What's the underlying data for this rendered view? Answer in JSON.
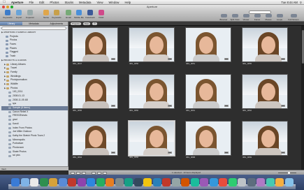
{
  "menubar": {
    "items": [
      "Aperture",
      "File",
      "Edit",
      "Photos",
      "Stacks",
      "Metadata",
      "View",
      "Window",
      "Help"
    ],
    "time": "Tue 8:44 AM"
  },
  "window": {
    "title": "Aperture"
  },
  "toolbar": {
    "left": [
      "Keywords",
      "Import",
      "Inspector",
      "Name",
      "Keywords",
      "Email",
      "Mobile Me",
      "Facebook",
      "Flickr"
    ],
    "right": [
      "Browser",
      "Split View",
      "Viewer",
      "Faces",
      "Places",
      "Loupe",
      "Full Screen"
    ],
    "search_placeholder": "Search"
  },
  "sidebar": {
    "tabs": [
      "Library",
      "Metadata",
      "Adjustments"
    ],
    "header_library": "APERTURE 3 SAMPLE LIBRARY",
    "library_items": [
      "Projects",
      "Photos",
      "Faces",
      "Places",
      "Flagged",
      "Trash"
    ],
    "header_projects": "PROJECTS & ALBUMS",
    "project_items": [
      "Library Albums",
      "Travel",
      "Family",
      "Weddings",
      "Photojournalism",
      "Wildlife",
      "Photos",
      "100_0311",
      "2008-01-13",
      "2008-11-05 48I",
      "sps",
      "Sample (8 items)",
      "Canon Rebel X",
      "FREEZEshots",
      "grad",
      "Kandi",
      "Index From Photos",
      "Joe Miller Outdoor",
      "Kathy the Sketch Photo Tours 2",
      "Minneapolis",
      "Portraiture",
      "Photoroom",
      "Skate Photos",
      "sci pics"
    ],
    "selected": "Sample (8 items)",
    "bottom_label": "Vault"
  },
  "browserbar": {
    "filter": "Projects",
    "sort": "Date"
  },
  "photos": [
    {
      "name": "IMG_0047"
    },
    {
      "name": "IMG_0050"
    },
    {
      "name": "IMG_0051"
    },
    {
      "name": "IMG_0055"
    },
    {
      "name": "IMG_0056"
    },
    {
      "name": "IMG_0060"
    },
    {
      "name": "IMG_0061"
    },
    {
      "name": "IMG_0062"
    },
    {
      "name": "IMG_0064"
    },
    {
      "name": "IMG_0066"
    },
    {
      "name": "IMG_0068"
    },
    {
      "name": "IMG_0069"
    }
  ],
  "selected_photo_index": 9,
  "statusbar": {
    "text": "1 selected - 13 items displayed"
  },
  "colors": {
    "selection": "#6d7d97",
    "dock": "#2c3f63",
    "grid_bg": "#2e2e2e"
  }
}
